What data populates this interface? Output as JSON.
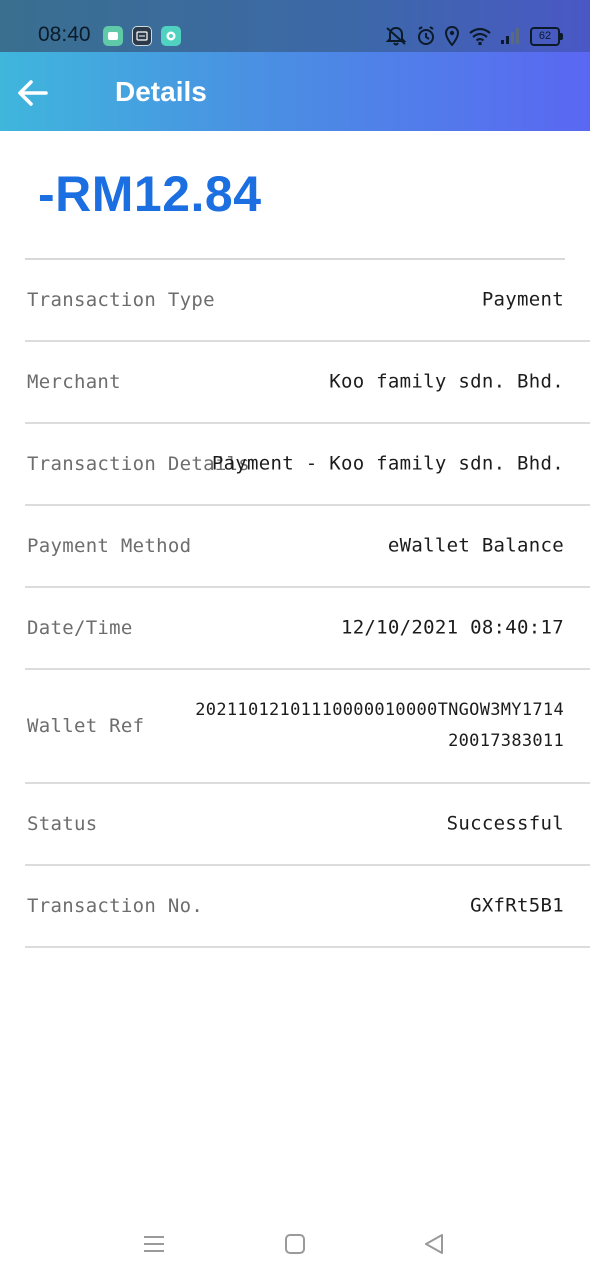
{
  "status_bar": {
    "time": "08:40",
    "battery": "62",
    "icons": [
      "app-notification-icon",
      "app-notification-icon",
      "app-notification-icon",
      "mute-icon",
      "alarm-icon",
      "location-icon",
      "wifi-icon",
      "signal-icon",
      "battery-icon"
    ]
  },
  "header": {
    "title": "Details",
    "back_icon": "arrow-left-icon",
    "gradient": [
      "#3fb6dc",
      "#5a67f2"
    ]
  },
  "amount": "-RM12.84",
  "amount_color": "#1b6fe0",
  "details": [
    {
      "label": "Transaction Type",
      "value": [
        "Payment"
      ]
    },
    {
      "label": "Merchant",
      "value": [
        "Koo family sdn. Bhd."
      ]
    },
    {
      "label": "Transaction Details",
      "value": [
        "Payment - Koo family sdn. Bhd."
      ]
    },
    {
      "label": "Payment Method",
      "value": [
        "eWallet Balance"
      ]
    },
    {
      "label": "Date/Time",
      "value": [
        "12/10/2021 08:40:17"
      ]
    },
    {
      "label": "Wallet Ref",
      "value": [
        "20211012101110000010000TNGOW3MY1714",
        "20017383011"
      ]
    },
    {
      "label": "Status",
      "value": [
        "Successful"
      ]
    },
    {
      "label": "Transaction No.",
      "value": [
        "GXfRt5B1"
      ]
    }
  ],
  "nav_bar": {
    "icons": [
      "menu-icon",
      "home-icon",
      "back-icon"
    ]
  }
}
